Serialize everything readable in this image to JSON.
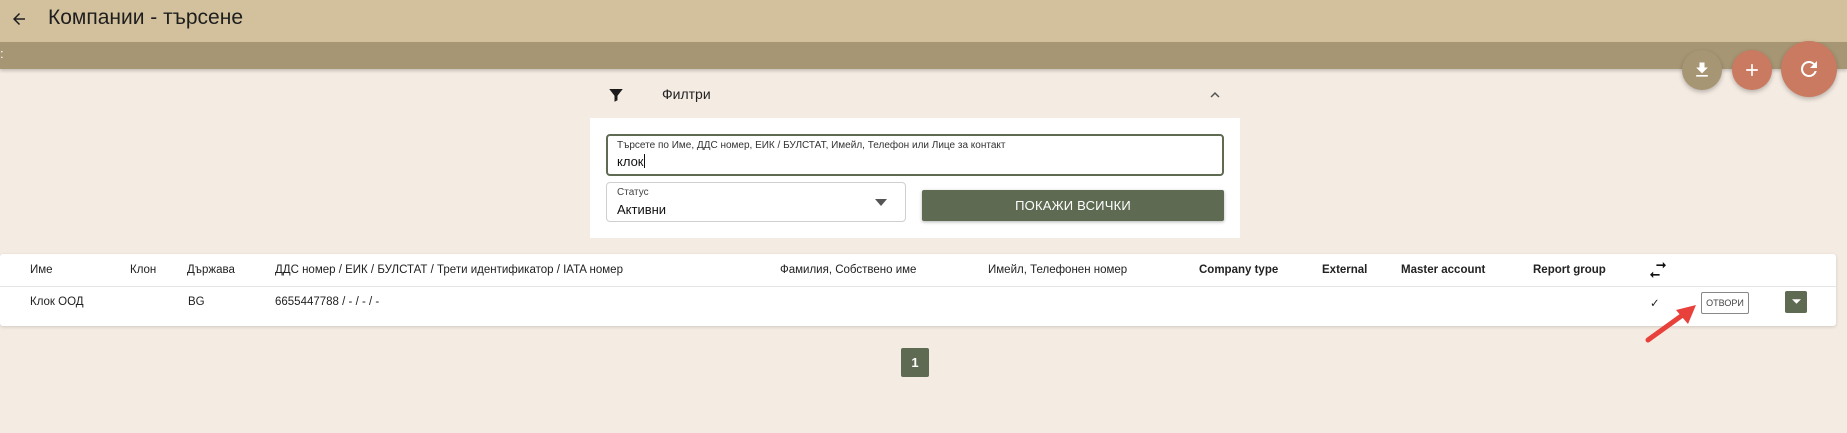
{
  "header": {
    "title": "Компании - търсене",
    "back_icon": "arrow-left-icon"
  },
  "subbar": {
    "handle": ":"
  },
  "fabs": {
    "download_icon": "download-icon",
    "add_icon": "plus-icon",
    "refresh_icon": "refresh-icon"
  },
  "filters": {
    "title": "Филтри",
    "search": {
      "label": "Търсете по Име, ДДС номер, ЕИК / БУЛСТАТ, Имейл, Телефон или Лице за контакт",
      "value": "клок"
    },
    "status": {
      "label": "Статус",
      "value": "Активни"
    },
    "show_all_label": "ПОКАЖИ ВСИЧКИ"
  },
  "table": {
    "headers": {
      "name": "Име",
      "branch": "Клон",
      "country": "Държава",
      "ids": "ДДС номер / ЕИК / БУЛСТАТ / Трети идентификатор / IATA номер",
      "person": "Фамилия, Собствено име",
      "contact": "Имейл, Телефонен номер",
      "company_type": "Company type",
      "external": "External",
      "master_account": "Master account",
      "report_group": "Report group"
    },
    "rows": [
      {
        "name": "Клок ООД",
        "branch": "",
        "country": "BG",
        "ids": "6655447788 / - / - / -",
        "person": "",
        "contact": "",
        "company_type": "",
        "external": "",
        "master_account": "",
        "report_group": "",
        "checked": "✓",
        "open_label": "ОТВОРИ"
      }
    ]
  },
  "pagination": {
    "current_page": "1"
  },
  "colors": {
    "primary": "#5e6a52",
    "accent": "#c97a60",
    "topbar": "#d3c19d",
    "subbar": "#a79674",
    "background": "#f4ebe2",
    "annotation": "#e8403a"
  }
}
